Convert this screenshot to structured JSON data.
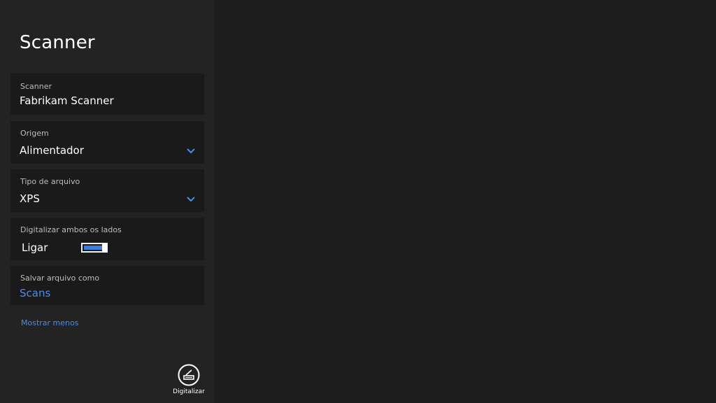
{
  "panel": {
    "title": "Scanner",
    "scanner": {
      "label": "Scanner",
      "value": "Fabrikam Scanner"
    },
    "source": {
      "label": "Origem",
      "value": "Alimentador"
    },
    "file_type": {
      "label": "Tipo de arquivo",
      "value": "XPS"
    },
    "duplex": {
      "label": "Digitalizar ambos os lados",
      "value": "Ligar",
      "on": true
    },
    "save_as": {
      "label": "Salvar arquivo como",
      "value": "Scans"
    },
    "show_less": "Mostrar menos",
    "scan_button_label": "Digitalizar"
  },
  "colors": {
    "accent": "#3b7fe0",
    "link": "#4a8de8",
    "panel_bg": "#232323",
    "card_bg": "#1a1a1a",
    "main_bg": "#1d1d1d"
  },
  "icons": {
    "dropdown": "chevron-down-icon",
    "scan": "scanner-icon"
  }
}
